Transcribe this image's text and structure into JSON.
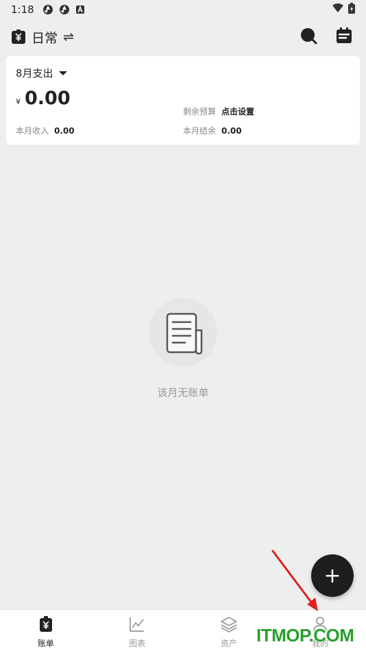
{
  "status_bar": {
    "time": "1:18"
  },
  "header": {
    "ledger_name": "日常",
    "swap_symbol": "⇌"
  },
  "summary": {
    "month_label": "8月支出",
    "currency": "¥",
    "expense_amount": "0.00",
    "budget_label": "剩余预算",
    "budget_action": "点击设置",
    "income_label": "本月收入",
    "income_value": "0.00",
    "balance_label": "本月结余",
    "balance_value": "0.00"
  },
  "empty_state": {
    "text": "该月无账单"
  },
  "fab": {
    "symbol": "+"
  },
  "nav": {
    "items": [
      {
        "label": "账单",
        "icon": "bill-icon"
      },
      {
        "label": "图表",
        "icon": "chart-icon"
      },
      {
        "label": "资产",
        "icon": "layers-icon"
      },
      {
        "label": "我的",
        "icon": "person-icon"
      }
    ]
  },
  "watermark": {
    "text": "ITMOP.COM"
  },
  "colors": {
    "accent": "#1e1e1e",
    "watermark": "#27a12a",
    "arrow": "#e02020"
  }
}
